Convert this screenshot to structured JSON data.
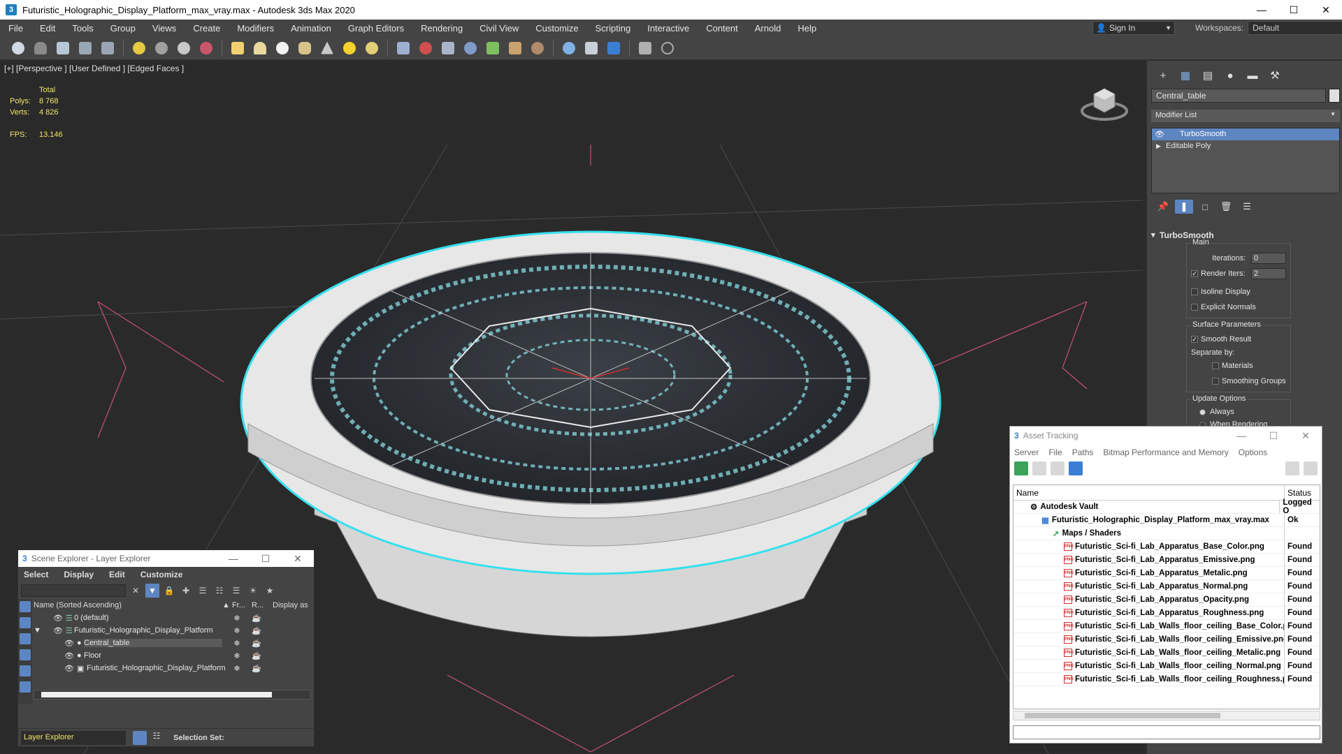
{
  "window": {
    "title": "Futuristic_Holographic_Display_Platform_max_vray.max - Autodesk 3ds Max 2020",
    "app_icon": "3"
  },
  "menu": [
    "File",
    "Edit",
    "Tools",
    "Group",
    "Views",
    "Create",
    "Modifiers",
    "Animation",
    "Graph Editors",
    "Rendering",
    "Civil View",
    "Customize",
    "Scripting",
    "Interactive",
    "Content",
    "Arnold",
    "Help"
  ],
  "signin": {
    "label": "Sign In"
  },
  "workspaces": {
    "label": "Workspaces:",
    "value": "Default"
  },
  "viewport": {
    "label": "[+] [Perspective ] [User Defined ] [Edged Faces ]",
    "stats": {
      "total_label": "Total",
      "polys_label": "Polys:",
      "polys": "8 768",
      "verts_label": "Verts:",
      "verts": "4 826",
      "fps_label": "FPS:",
      "fps": "13.146"
    }
  },
  "command_panel": {
    "object_name": "Central_table",
    "modifier_list_label": "Modifier List",
    "stack": [
      {
        "label": "TurboSmooth",
        "selected": true
      },
      {
        "label": "Editable Poly",
        "selected": false
      }
    ],
    "rollout_title": "TurboSmooth",
    "main_label": "Main",
    "iterations_label": "Iterations:",
    "iterations": "0",
    "render_iters_label": "Render Iters:",
    "render_iters": "2",
    "isoline_label": "Isoline Display",
    "explicit_normals_label": "Explicit Normals",
    "surface_params_label": "Surface Parameters",
    "smooth_result_label": "Smooth Result",
    "separate_by_label": "Separate by:",
    "materials_label": "Materials",
    "smoothing_groups_label": "Smoothing Groups",
    "update_options_label": "Update Options",
    "always_label": "Always",
    "when_rendering_label": "When Rendering"
  },
  "scene_explorer": {
    "title": "Scene Explorer - Layer Explorer",
    "menu": [
      "Select",
      "Display",
      "Edit",
      "Customize"
    ],
    "columns": {
      "name": "Name (Sorted Ascending)",
      "frozen": "▲ Fr...",
      "render": "R...",
      "display": "Display as"
    },
    "rows": [
      {
        "label": "0 (default)",
        "indent": 0
      },
      {
        "label": "Futuristic_Holographic_Display_Platform",
        "indent": 0
      },
      {
        "label": "Central_table",
        "indent": 1
      },
      {
        "label": "Floor",
        "indent": 1
      },
      {
        "label": "Futuristic_Holographic_Display_Platform",
        "indent": 1
      }
    ],
    "layer_explorer": "Layer Explorer",
    "selection_set": "Selection Set:"
  },
  "asset_tracking": {
    "title": "Asset Tracking",
    "menu": [
      "Server",
      "File",
      "Paths",
      "Bitmap Performance and Memory",
      "Options"
    ],
    "col_name": "Name",
    "col_status": "Status",
    "rows": [
      {
        "name": "Autodesk Vault",
        "status": "Logged O"
      },
      {
        "name": "Futuristic_Holographic_Display_Platform_max_vray.max",
        "status": "Ok"
      },
      {
        "name": "Maps / Shaders",
        "status": ""
      },
      {
        "name": "Futuristic_Sci-fi_Lab_Apparatus_Base_Color.png",
        "status": "Found"
      },
      {
        "name": "Futuristic_Sci-fi_Lab_Apparatus_Emissive.png",
        "status": "Found"
      },
      {
        "name": "Futuristic_Sci-fi_Lab_Apparatus_Metalic.png",
        "status": "Found"
      },
      {
        "name": "Futuristic_Sci-fi_Lab_Apparatus_Normal.png",
        "status": "Found"
      },
      {
        "name": "Futuristic_Sci-fi_Lab_Apparatus_Opacity.png",
        "status": "Found"
      },
      {
        "name": "Futuristic_Sci-fi_Lab_Apparatus_Roughness.png",
        "status": "Found"
      },
      {
        "name": "Futuristic_Sci-fi_Lab_Walls_floor_ceiling_Base_Color.png",
        "status": "Found"
      },
      {
        "name": "Futuristic_Sci-fi_Lab_Walls_floor_ceiling_Emissive.png",
        "status": "Found"
      },
      {
        "name": "Futuristic_Sci-fi_Lab_Walls_floor_ceiling_Metalic.png",
        "status": "Found"
      },
      {
        "name": "Futuristic_Sci-fi_Lab_Walls_floor_ceiling_Normal.png",
        "status": "Found"
      },
      {
        "name": "Futuristic_Sci-fi_Lab_Walls_floor_ceiling_Roughness.png",
        "status": "Found"
      }
    ]
  },
  "colors": {
    "accent": "#5d85c2",
    "selection_cyan": "#36e0ee",
    "grid_pink": "#c8507a"
  }
}
